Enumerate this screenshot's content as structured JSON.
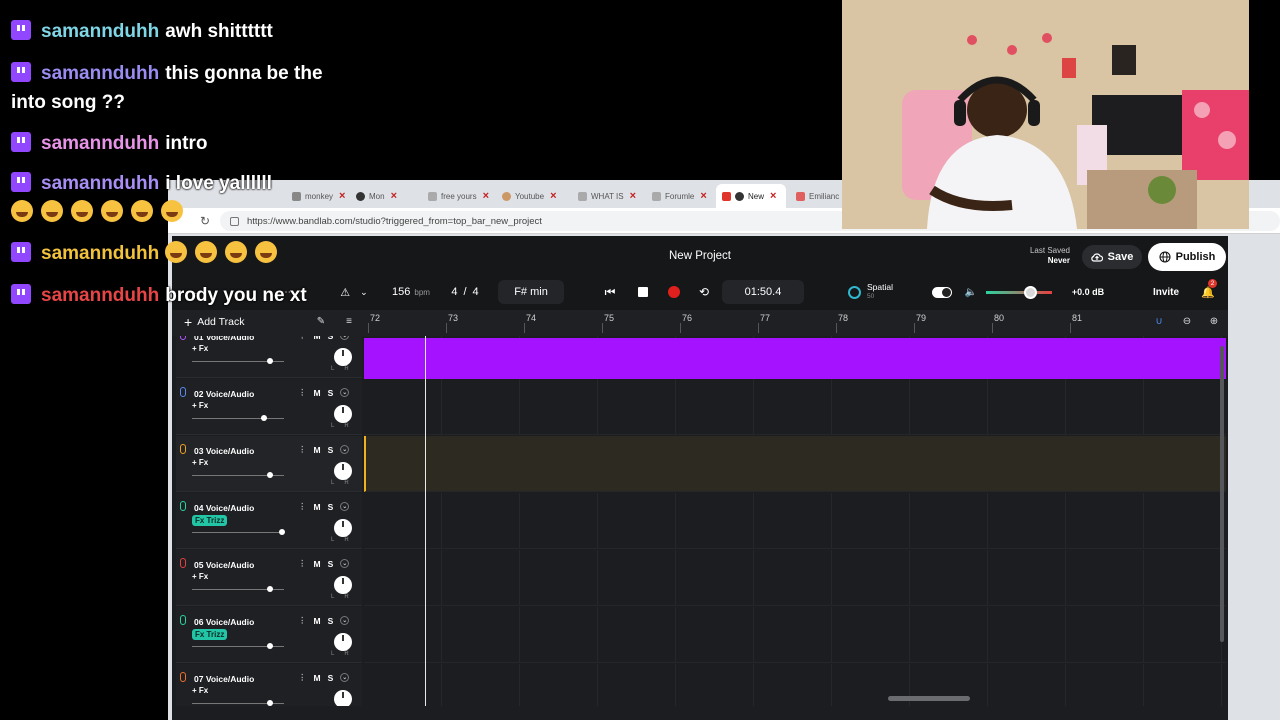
{
  "chat": {
    "messages": [
      {
        "user": "samannduhh",
        "color": "#7fd6e6",
        "text": "awh shitttttt"
      },
      {
        "user": "samannduhh",
        "color": "#9a8df2",
        "text": "this gonna be the into song ??"
      },
      {
        "user": "samannduhh",
        "color": "#e894e8",
        "text": "intro"
      },
      {
        "user": "samannduhh",
        "color": "#a88ef5",
        "text": "i love yallllll"
      },
      {
        "user": "samannduhh",
        "color": "#f2c23c",
        "text": ""
      },
      {
        "user": "samannduhh",
        "color": "#e84646",
        "text": "brody you ne xt"
      }
    ]
  },
  "browser": {
    "tabs": [
      {
        "label": "monkey",
        "fav": "#888888"
      },
      {
        "label": "Mon",
        "fav": "#333333"
      },
      {
        "label": "free yours",
        "fav": "#aaaaaa"
      },
      {
        "label": "Youtube",
        "fav": "#cc9966"
      },
      {
        "label": "WHAT IS",
        "fav": "#aaaaaa"
      },
      {
        "label": "Forumle",
        "fav": "#aaaaaa"
      },
      {
        "label": "New",
        "fav": "#e0352b"
      },
      {
        "label": "Emilianc",
        "fav": "#e06060"
      }
    ],
    "url": "https://www.bandlab.com/studio?triggered_from=top_bar_new_project"
  },
  "header": {
    "title": "New Project",
    "last_saved_label": "Last Saved",
    "last_saved_value": "Never",
    "save_label": "Save",
    "publish_label": "Publish"
  },
  "transport": {
    "bpm": "156",
    "bpm_unit": "bpm",
    "time_sig_num": "4",
    "time_sig_sep": "/",
    "time_sig_den": "4",
    "key": "F# min",
    "time": "01:50.4",
    "spatial_label": "Spatial",
    "spatial_value": "50",
    "volume_db": "+0.0 dB",
    "invite_label": "Invite",
    "notif_count": "2"
  },
  "timeline": {
    "add_track_label": "Add Track",
    "bars": [
      "72",
      "73",
      "74",
      "75",
      "76",
      "77",
      "78",
      "79",
      "80",
      "81"
    ]
  },
  "tracks": [
    {
      "name": "01 Voice/Audio",
      "fx": "+ Fx",
      "fx_badge": false,
      "vol": 0.82,
      "mic_color": "#b455ff"
    },
    {
      "name": "02 Voice/Audio",
      "fx": "+ Fx",
      "fx_badge": false,
      "vol": 0.75,
      "mic_color": "#5a8cf0"
    },
    {
      "name": "03 Voice/Audio",
      "fx": "+ Fx",
      "fx_badge": false,
      "vol": 0.82,
      "mic_color": "#f0a020"
    },
    {
      "name": "04 Voice/Audio",
      "fx": "Fx Trizz",
      "fx_badge": true,
      "vol": 0.95,
      "mic_color": "#2bd3a0"
    },
    {
      "name": "05 Voice/Audio",
      "fx": "+ Fx",
      "fx_badge": false,
      "vol": 0.82,
      "mic_color": "#e84040"
    },
    {
      "name": "06 Voice/Audio",
      "fx": "Fx Trizz",
      "fx_badge": true,
      "vol": 0.81,
      "mic_color": "#2bd3a0"
    },
    {
      "name": "07 Voice/Audio",
      "fx": "+ Fx",
      "fx_badge": false,
      "vol": 0.82,
      "mic_color": "#f07030"
    }
  ],
  "colors": {
    "clip": "#a412ff",
    "record": "#e0201c",
    "selected_track": "#f0b020",
    "twitch": "#9146ff"
  }
}
